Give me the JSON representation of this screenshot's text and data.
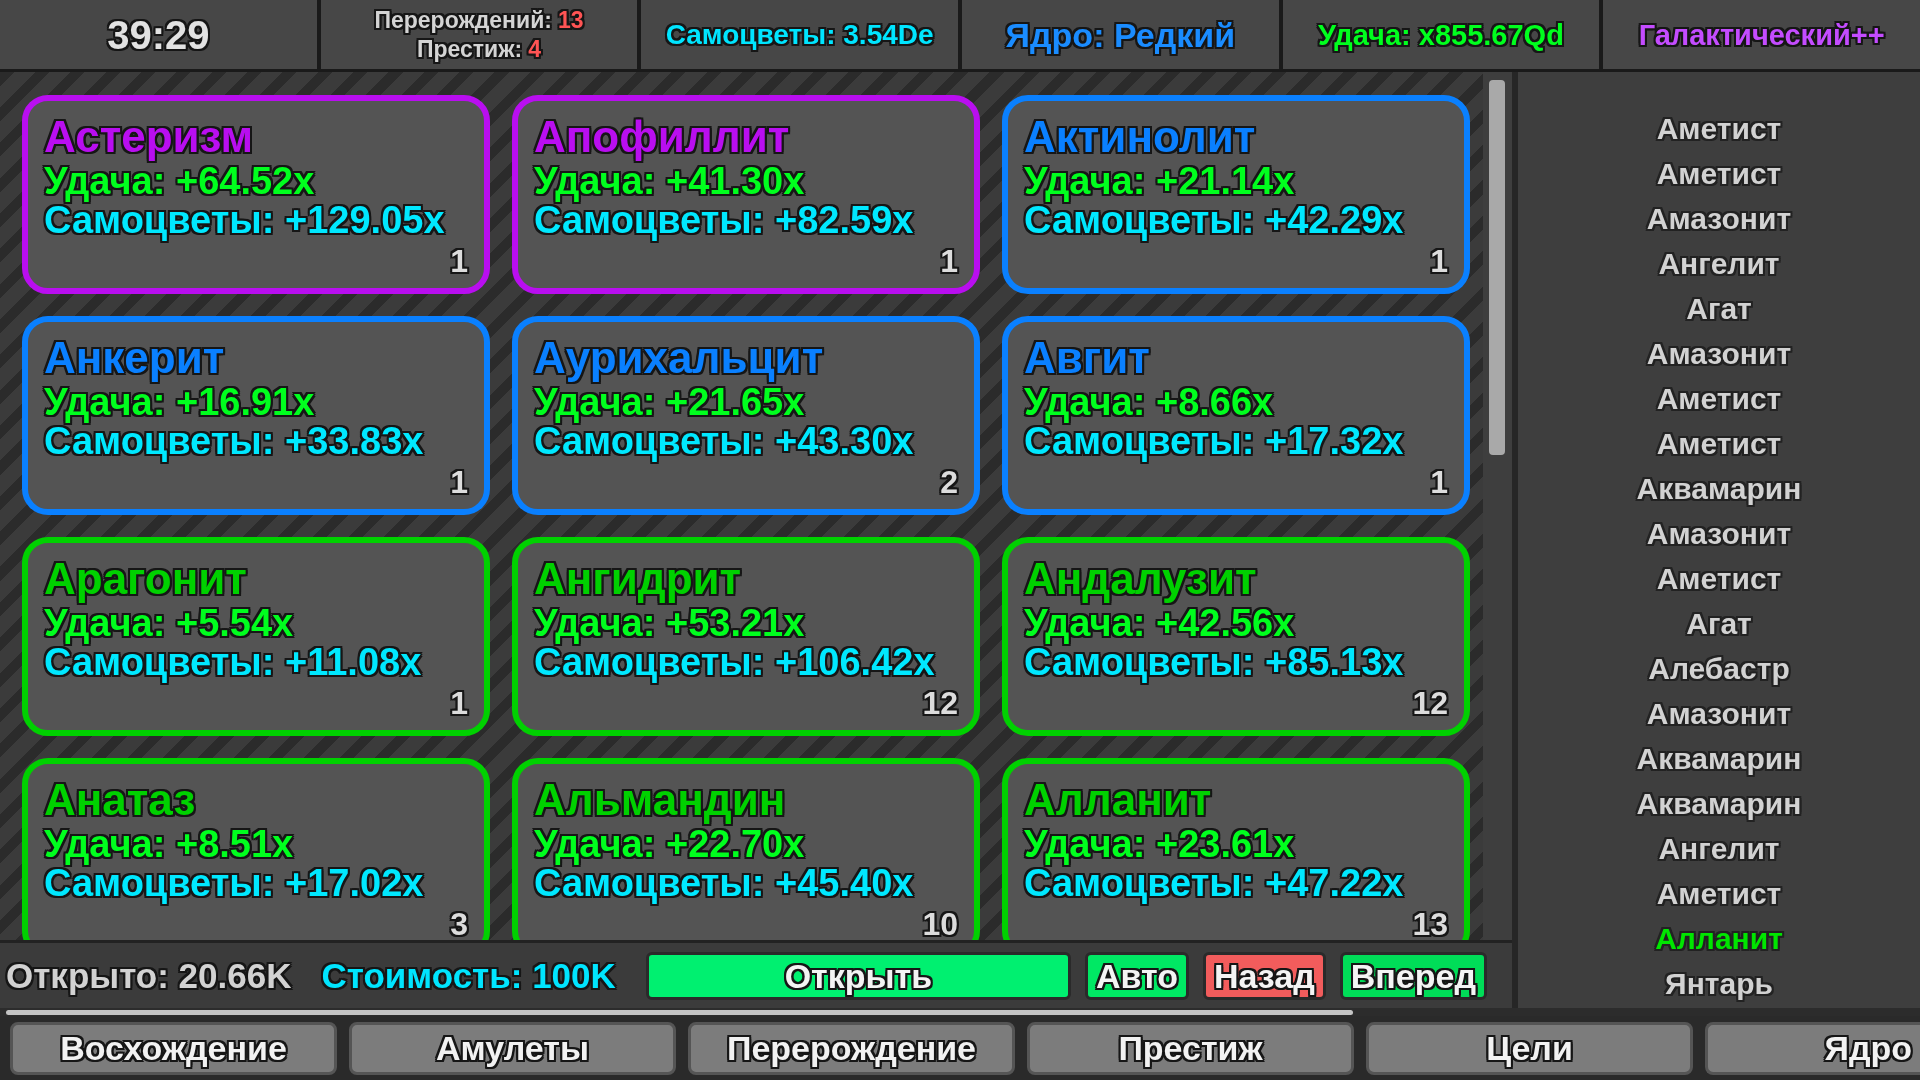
{
  "top_bar": {
    "timer": "39:29",
    "rebirths": {
      "label": "Перерождений:",
      "value": "13"
    },
    "prestige": {
      "label": "Престиж:",
      "value": "4"
    },
    "gems": "Самоцветы: 3.54De",
    "core": "Ядро: Редкий",
    "luck": "Удача: x855.67Qd",
    "rank": "Галактический++"
  },
  "cards": [
    {
      "name": "Астеризм",
      "luck": "Удача: +64.52x",
      "gems": "Самоцветы: +129.05x",
      "count": "1",
      "color": "#b90ef0"
    },
    {
      "name": "Апофиллит",
      "luck": "Удача: +41.30x",
      "gems": "Самоцветы: +82.59x",
      "count": "1",
      "color": "#b90ef0"
    },
    {
      "name": "Актинолит",
      "luck": "Удача: +21.14x",
      "gems": "Самоцветы: +42.29x",
      "count": "1",
      "color": "#0a80ff"
    },
    {
      "name": "Анкерит",
      "luck": "Удача: +16.91x",
      "gems": "Самоцветы: +33.83x",
      "count": "1",
      "color": "#0a80ff"
    },
    {
      "name": "Аурихальцит",
      "luck": "Удача: +21.65x",
      "gems": "Самоцветы: +43.30x",
      "count": "2",
      "color": "#0a80ff"
    },
    {
      "name": "Авгит",
      "luck": "Удача: +8.66x",
      "gems": "Самоцветы: +17.32x",
      "count": "1",
      "color": "#0a80ff"
    },
    {
      "name": "Арагонит",
      "luck": "Удача: +5.54x",
      "gems": "Самоцветы: +11.08x",
      "count": "1",
      "color": "#00d100"
    },
    {
      "name": "Ангидрит",
      "luck": "Удача: +53.21x",
      "gems": "Самоцветы: +106.42x",
      "count": "12",
      "color": "#00d100"
    },
    {
      "name": "Андалузит",
      "luck": "Удача: +42.56x",
      "gems": "Самоцветы: +85.13x",
      "count": "12",
      "color": "#00d100"
    },
    {
      "name": "Анатаз",
      "luck": "Удача: +8.51x",
      "gems": "Самоцветы: +17.02x",
      "count": "3",
      "color": "#00d100"
    },
    {
      "name": "Альмандин",
      "luck": "Удача: +22.70x",
      "gems": "Самоцветы: +45.40x",
      "count": "10",
      "color": "#00d100"
    },
    {
      "name": "Алланит",
      "luck": "Удача: +23.61x",
      "gems": "Самоцветы: +47.22x",
      "count": "13",
      "color": "#00d100"
    }
  ],
  "log": [
    {
      "label": "Аметист",
      "color": "#d2d2d2"
    },
    {
      "label": "Аметист",
      "color": "#d2d2d2"
    },
    {
      "label": "Амазонит",
      "color": "#d2d2d2"
    },
    {
      "label": "Ангелит",
      "color": "#d2d2d2"
    },
    {
      "label": "Агат",
      "color": "#d2d2d2"
    },
    {
      "label": "Амазонит",
      "color": "#d2d2d2"
    },
    {
      "label": "Аметист",
      "color": "#d2d2d2"
    },
    {
      "label": "Аметист",
      "color": "#d2d2d2"
    },
    {
      "label": "Аквамарин",
      "color": "#d2d2d2"
    },
    {
      "label": "Амазонит",
      "color": "#d2d2d2"
    },
    {
      "label": "Аметист",
      "color": "#d2d2d2"
    },
    {
      "label": "Агат",
      "color": "#d2d2d2"
    },
    {
      "label": "Алебастр",
      "color": "#d2d2d2"
    },
    {
      "label": "Амазонит",
      "color": "#d2d2d2"
    },
    {
      "label": "Аквамарин",
      "color": "#d2d2d2"
    },
    {
      "label": "Аквамарин",
      "color": "#d2d2d2"
    },
    {
      "label": "Ангелит",
      "color": "#d2d2d2"
    },
    {
      "label": "Аметист",
      "color": "#d2d2d2"
    },
    {
      "label": "Алланит",
      "color": "#00e600"
    },
    {
      "label": "Янтарь",
      "color": "#d2d2d2"
    }
  ],
  "footer": {
    "opened": "Открыто: 20.66K",
    "cost": "Стоимость: 100K",
    "buttons": [
      {
        "label": "Открыть",
        "color": "#00f070"
      },
      {
        "label": "Авто",
        "color": "#00e864"
      },
      {
        "label": "Назад",
        "color": "#f25c5c"
      },
      {
        "label": "Вперед",
        "color": "#00dd58"
      }
    ]
  },
  "tabs": [
    "Восхождение",
    "Амулеты",
    "Перерождение",
    "Престиж",
    "Цели",
    "Ядро"
  ]
}
